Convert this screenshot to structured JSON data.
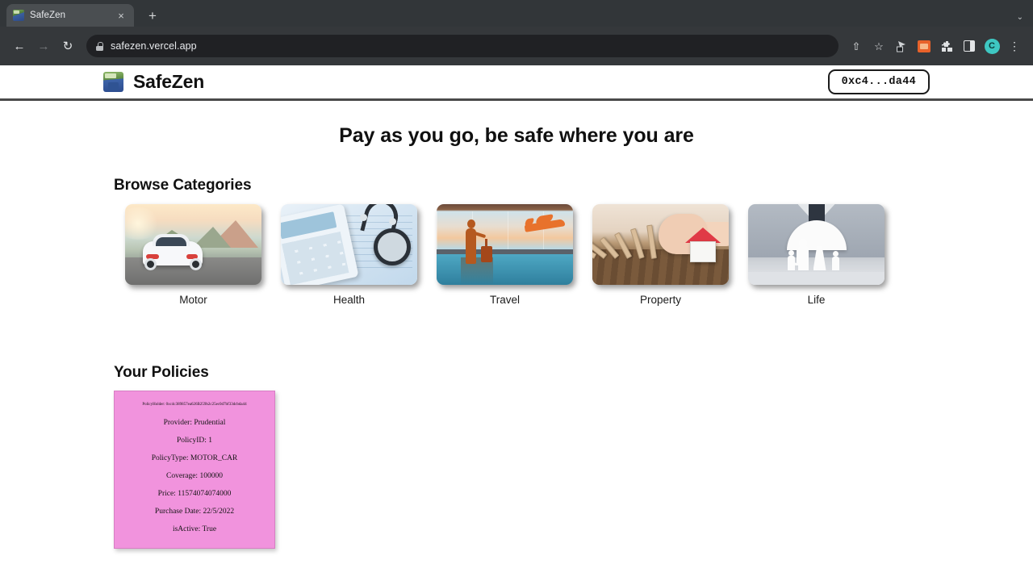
{
  "browser": {
    "tab": {
      "title": "SafeZen",
      "favicon": "safezen-favicon",
      "close": "×"
    },
    "new_tab": "+",
    "window_caret": "⌄",
    "nav": {
      "back": "←",
      "forward": "→",
      "reload": "↻"
    },
    "omnibox": {
      "url": "safezen.vercel.app",
      "lock": "lock-icon"
    },
    "actions": {
      "share": "⇧",
      "bookmark": "☆",
      "ext_puzzle": "🧩",
      "kebab": "⋮",
      "avatar_initial": "C"
    }
  },
  "site": {
    "brand": {
      "name": "SafeZen",
      "logo": "safezen-logo"
    },
    "wallet_button": "0xc4...da44",
    "tagline": "Pay as you go, be safe where you are"
  },
  "categories": {
    "heading": "Browse Categories",
    "items": [
      {
        "label": "Motor",
        "image": "white-car-on-mountain-road"
      },
      {
        "label": "Health",
        "image": "calculator-and-stethoscope"
      },
      {
        "label": "Travel",
        "image": "traveler-silhouette-airport-window-with-airplane"
      },
      {
        "label": "Property",
        "image": "hand-stopping-falling-dominoes-protecting-house"
      },
      {
        "label": "Life",
        "image": "businessman-holding-umbrella-over-paper-family"
      }
    ]
  },
  "policies": {
    "heading": "Your Policies",
    "cards": [
      {
        "policy_holder": "PolicyHolder: 0xc4c389857ea626B259b2c25ec0d7bf33dcbda44",
        "provider": "Provider: Prudential",
        "policy_id": "PolicyID: 1",
        "policy_type": "PolicyType: MOTOR_CAR",
        "coverage": "Coverage: 100000",
        "price": "Price: 11574074074000",
        "purchase_date": "Purchase Date: 22/5/2022",
        "is_active": "isActive: True"
      }
    ]
  },
  "colors": {
    "chrome_tabstrip": "#323639",
    "chrome_toolbar": "#35383b",
    "omnibox": "#202124",
    "page_bg": "#ffffff",
    "card_pink": "#f193dd",
    "header_rule": "#4a4a4a"
  }
}
